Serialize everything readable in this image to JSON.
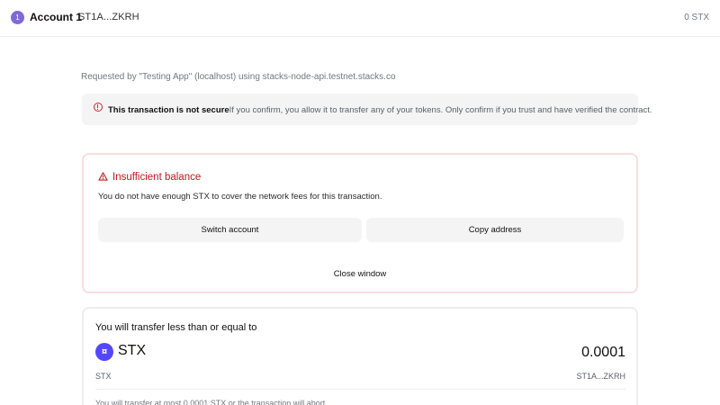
{
  "header": {
    "account_index": "1",
    "account_name": "Account 1",
    "account_address": "ST1A...ZKRH",
    "balance": "0 STX"
  },
  "request": {
    "requested_by": "Requested by \"Testing App\" (localhost) using stacks-node-api.testnet.stacks.co"
  },
  "security_warning": {
    "title": "This transaction is not secure",
    "message": "If you confirm, you allow it to transfer any of your tokens. Only confirm if you trust and have verified the contract."
  },
  "error": {
    "title": "Insufficient balance",
    "description": "You do not have enough STX to cover the network fees for this transaction.",
    "switch_account_label": "Switch account",
    "copy_address_label": "Copy address",
    "close_window_label": "Close window"
  },
  "transfer": {
    "title": "You will transfer less than or equal to",
    "token_icon": "¤",
    "token_symbol": "STX",
    "amount": "0.0001",
    "token_name": "STX",
    "address": "ST1A...ZKRH",
    "note": "You will transfer at most 0.0001 STX or the transaction will abort."
  },
  "colors": {
    "accent": "#7f6ad6",
    "stx_brand": "#5546ff",
    "error": "#c6161b",
    "error_border": "#f9dedf"
  }
}
